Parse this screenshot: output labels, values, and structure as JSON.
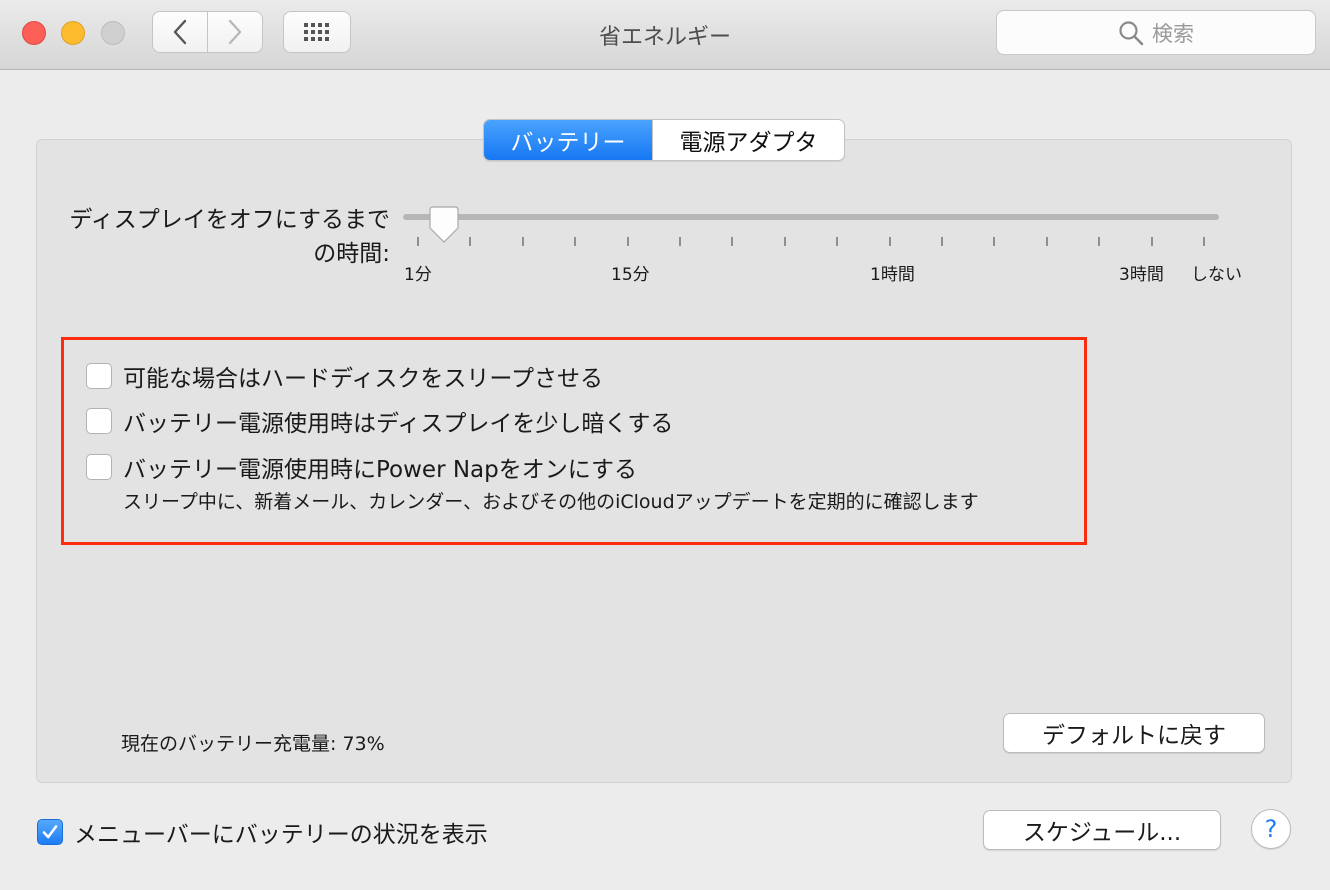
{
  "window": {
    "title": "省エネルギー"
  },
  "search": {
    "placeholder": "検索"
  },
  "tabs": [
    {
      "label": "バッテリー",
      "selected": true
    },
    {
      "label": "電源アダプタ",
      "selected": false
    }
  ],
  "display_sleep": {
    "label_line1": "ディスプレイをオフにするまで",
    "label_line2": "の時間:",
    "value": "1分",
    "tick_labels": [
      "1分",
      "15分",
      "1時間",
      "3時間",
      "しない"
    ]
  },
  "options": [
    {
      "label": "可能な場合はハードディスクをスリープさせる",
      "checked": false
    },
    {
      "label": "バッテリー電源使用時はディスプレイを少し暗くする",
      "checked": false
    },
    {
      "label": "バッテリー電源使用時にPower Napをオンにする",
      "checked": false,
      "note": "スリープ中に、新着メール、カレンダー、およびその他のiCloudアップデートを定期的に確認します"
    }
  ],
  "battery_status": "現在のバッテリー充電量: 73%",
  "buttons": {
    "restore_defaults": "デフォルトに戻す",
    "schedule": "スケジュール...",
    "help": "?"
  },
  "menubar_option": {
    "label": "メニューバーにバッテリーの状況を表示",
    "checked": true
  },
  "colors": {
    "accent": "#1677f3",
    "highlight_box": "#fa2d11"
  }
}
